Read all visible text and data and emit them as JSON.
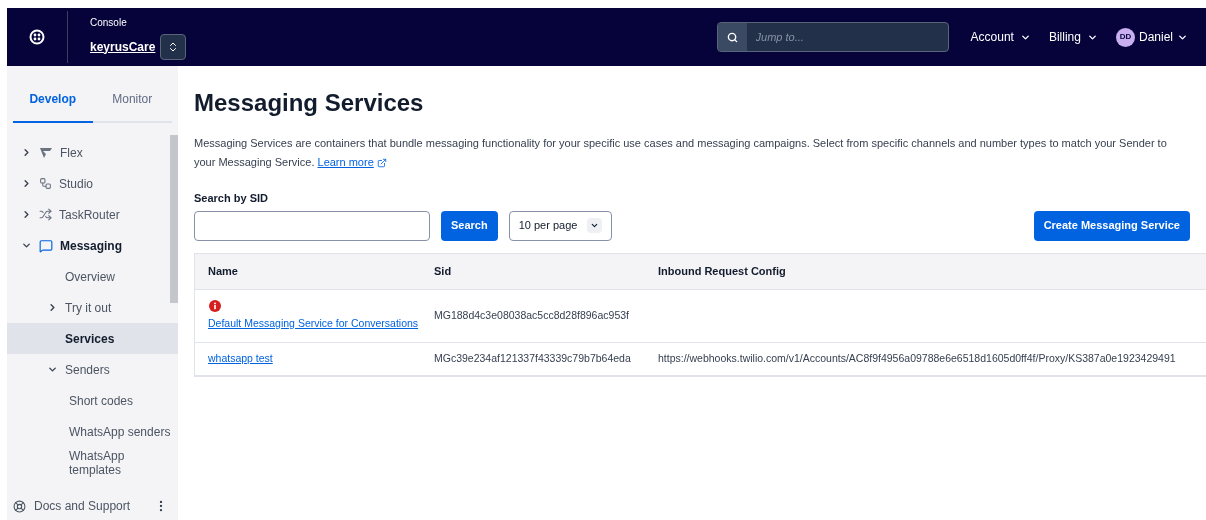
{
  "header": {
    "console_label": "Console",
    "account_name": "keyrusCare",
    "search": {
      "placeholder": "Jump to..."
    },
    "menus": [
      "Account",
      "Billing"
    ],
    "user": {
      "initials": "DD",
      "name": "Daniel"
    }
  },
  "sidebar": {
    "tabs": [
      {
        "label": "Develop",
        "selected": true
      },
      {
        "label": "Monitor",
        "selected": false
      }
    ],
    "items": [
      {
        "label": "Flex",
        "kind": "flex",
        "expanded": false,
        "selected": false
      },
      {
        "label": "Studio",
        "kind": "studio",
        "expanded": false,
        "selected": false
      },
      {
        "label": "TaskRouter",
        "kind": "taskrouter",
        "expanded": false,
        "selected": false
      },
      {
        "label": "Messaging",
        "kind": "messaging",
        "expanded": true,
        "selected": false,
        "children": [
          {
            "label": "Overview",
            "selected": false
          },
          {
            "label": "Try it out",
            "expanded": false,
            "selected": false
          },
          {
            "label": "Services",
            "selected": true
          },
          {
            "label": "Senders",
            "expanded": true,
            "selected": false,
            "children": [
              {
                "label": "Short codes",
                "selected": false
              },
              {
                "label": "WhatsApp senders",
                "selected": false
              },
              {
                "label": "WhatsApp templates",
                "selected": false
              }
            ]
          }
        ]
      }
    ],
    "footer": "Docs and Support"
  },
  "page": {
    "title": "Messaging Services",
    "description": "Messaging Services are containers that bundle messaging functionality for your specific use cases and messaging campaigns. Select from specific channels and number types to match your Sender to your Messaging Service.",
    "learn_more": "Learn more",
    "search_label": "Search by SID",
    "search_button": "Search",
    "per_page": "10 per page",
    "create_button": "Create Messaging Service",
    "table": {
      "columns": [
        "Name",
        "Sid",
        "Inbound Request Config"
      ],
      "rows": [
        {
          "name": "Default Messaging Service for Conversations",
          "alert": true,
          "sid": "MG188d4c3e08038ac5cc8d28f896ac953f"
        },
        {
          "name": "whatsapp test",
          "alert": false,
          "sid": "MGc39e234af121337f43339c79b7b64eda",
          "inbound": "https://webhooks.twilio.com/v1/Accounts/AC8f9f4956a09788e6e6518d1605d0ff4f/Proxy/KS387a0e1923429491"
        }
      ]
    }
  }
}
